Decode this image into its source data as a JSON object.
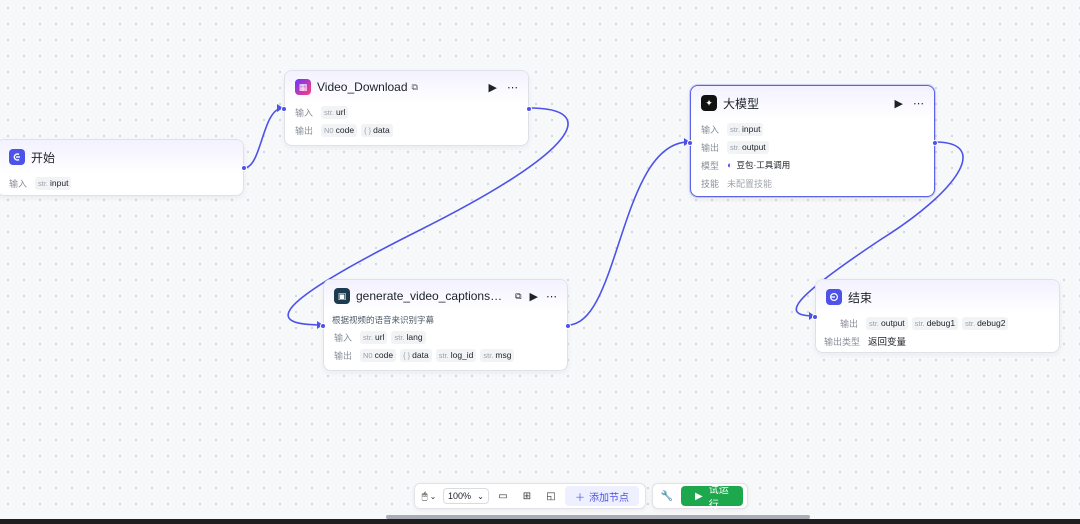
{
  "nodes": {
    "start": {
      "title": "开始",
      "input_label": "输入",
      "input_type": "str.",
      "input_name": "input"
    },
    "video_download": {
      "title": "Video_Download",
      "input_label": "输入",
      "input_type": "str.",
      "input_name": "url",
      "output_label": "输出",
      "out1_type": "N0",
      "out1_name": "code",
      "out2_type": "{ }",
      "out2_name": "data"
    },
    "captions": {
      "title": "generate_video_captions_s...",
      "description": "根据视频的语音来识别字幕",
      "input_label": "输入",
      "in1_type": "str.",
      "in1_name": "url",
      "in2_type": "str.",
      "in2_name": "lang",
      "output_label": "输出",
      "out1_type": "N0",
      "out1_name": "code",
      "out2_type": "{ }",
      "out2_name": "data",
      "out3_type": "str.",
      "out3_name": "log_id",
      "out4_type": "str.",
      "out4_name": "msg"
    },
    "llm": {
      "title": "大模型",
      "input_label": "输入",
      "input_type": "str.",
      "input_name": "input",
      "output_label": "输出",
      "output_type": "str.",
      "output_name": "output",
      "model_label": "模型",
      "model_value": "豆包·工具调用",
      "skill_label": "技能",
      "skill_value": "未配置技能"
    },
    "end": {
      "title": "结束",
      "output_label": "输出",
      "out1_type": "str.",
      "out1_name": "output",
      "out2_type": "str.",
      "out2_name": "debug1",
      "out3_type": "str.",
      "out3_name": "debug2",
      "output_type_label": "输出类型",
      "output_type_value": "返回变量"
    }
  },
  "toolbar": {
    "zoom": "100%",
    "add_node": "添加节点",
    "run": "试运行"
  },
  "colors": {
    "accent": "#4d53e8",
    "run_green": "#1ea84e",
    "edge": "#4d53e8"
  },
  "icons": {
    "start": "start-icon",
    "video_download": "plugin-icon",
    "captions": "plugin-icon",
    "llm": "llm-icon",
    "end": "end-icon"
  }
}
